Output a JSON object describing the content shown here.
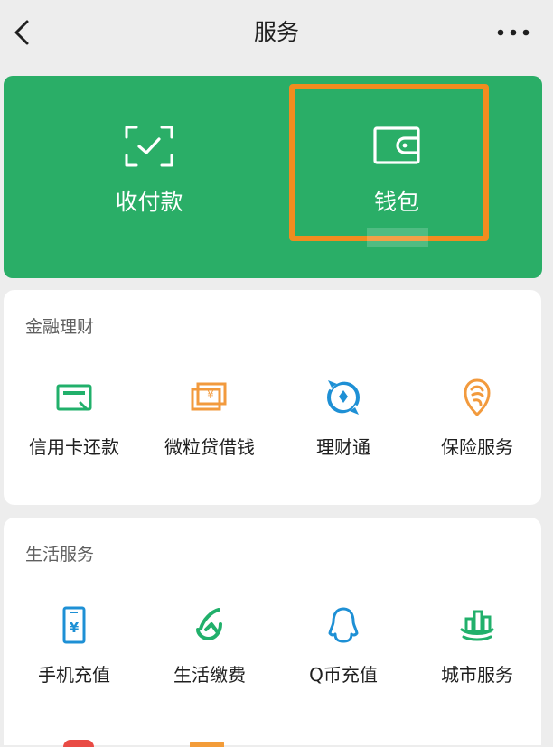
{
  "header": {
    "title": "服务"
  },
  "hero": {
    "pay_label": "收付款",
    "wallet_label": "钱包"
  },
  "finance": {
    "title": "金融理财",
    "items": [
      {
        "label": "信用卡还款",
        "icon": "credit-card-icon"
      },
      {
        "label": "微粒贷借钱",
        "icon": "loan-card-icon"
      },
      {
        "label": "理财通",
        "icon": "wealth-icon"
      },
      {
        "label": "保险服务",
        "icon": "insurance-icon"
      }
    ]
  },
  "life": {
    "title": "生活服务",
    "items": [
      {
        "label": "手机充值",
        "icon": "phone-topup-icon"
      },
      {
        "label": "生活缴费",
        "icon": "bill-payment-icon"
      },
      {
        "label": "Q币充值",
        "icon": "qq-coin-icon"
      },
      {
        "label": "城市服务",
        "icon": "city-services-icon"
      }
    ]
  },
  "colors": {
    "background": "#ededed",
    "hero_green": "#2aae67",
    "highlight_orange": "#f28c1f",
    "text_primary": "#1f1f1f",
    "text_secondary": "#5f5f5f"
  }
}
